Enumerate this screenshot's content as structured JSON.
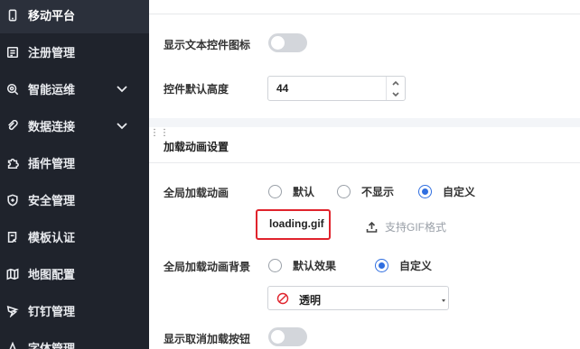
{
  "sidebar": {
    "items": [
      {
        "label": "移动平台",
        "icon": "mobile-icon",
        "active": true
      },
      {
        "label": "注册管理",
        "icon": "register-icon"
      },
      {
        "label": "智能运维",
        "icon": "search-gear-icon",
        "expandable": true
      },
      {
        "label": "数据连接",
        "icon": "link-icon",
        "expandable": true
      },
      {
        "label": "插件管理",
        "icon": "puzzle-icon"
      },
      {
        "label": "安全管理",
        "icon": "shield-icon"
      },
      {
        "label": "模板认证",
        "icon": "template-icon"
      },
      {
        "label": "地图配置",
        "icon": "map-icon"
      },
      {
        "label": "钉钉管理",
        "icon": "dingtalk-icon"
      },
      {
        "label": "字体管理",
        "icon": "font-icon"
      }
    ]
  },
  "settings": {
    "show_text_icon_label": "显示文本控件图标",
    "show_text_icon_on": false,
    "default_height_label": "控件默认高度",
    "default_height_value": "44",
    "loading_section_title": "加载动画设置",
    "global_loading_label": "全局加载动画",
    "global_loading_options": [
      "默认",
      "不显示",
      "自定义"
    ],
    "global_loading_selected": "自定义",
    "file_name": "loading.gif",
    "upload_hint": "支持GIF格式",
    "loading_bg_label": "全局加载动画背景",
    "loading_bg_options": [
      "默认效果",
      "自定义"
    ],
    "loading_bg_selected": "自定义",
    "bg_select_value": "透明",
    "show_cancel_label": "显示取消加载按钮",
    "show_cancel_on": false
  },
  "colors": {
    "sidebar_bg": "#1f232c",
    "accent": "#2f6ee0",
    "highlight_border": "#e0232c"
  }
}
